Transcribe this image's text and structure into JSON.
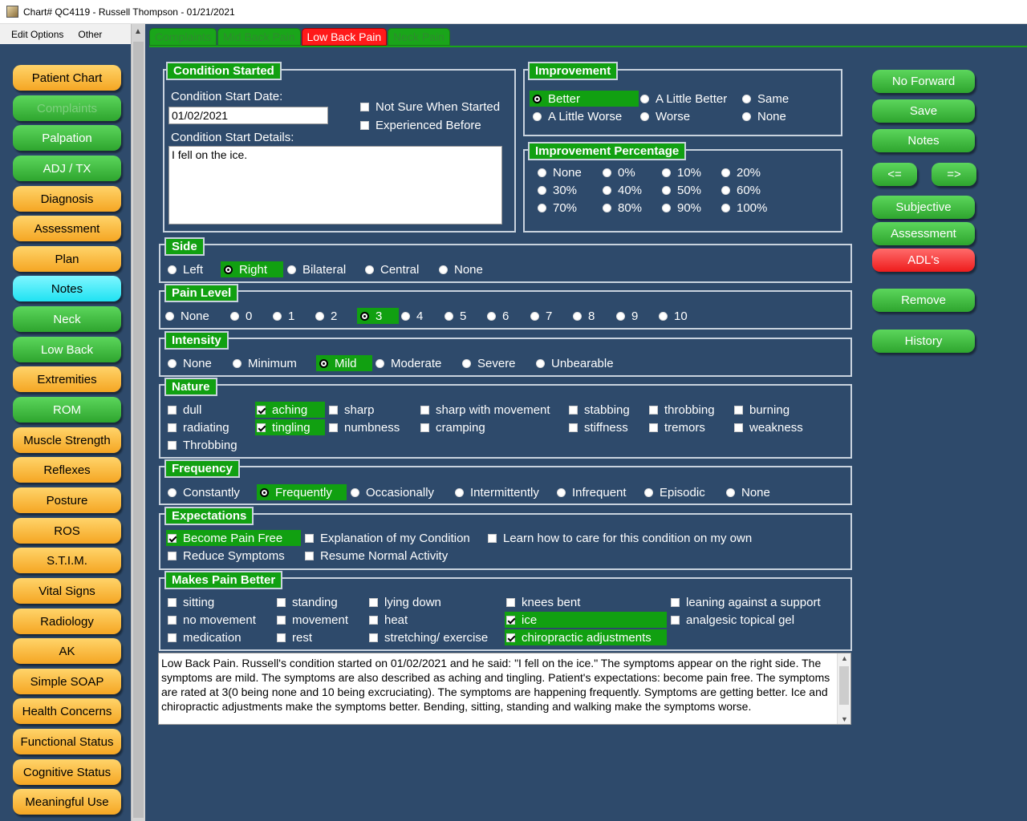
{
  "window": {
    "title": "Chart# QC4119 - Russell Thompson - 01/21/2021"
  },
  "menu": {
    "edit_options": "Edit Options",
    "other": "Other"
  },
  "sidebar": [
    "Patient Chart",
    "Complaints",
    "Palpation",
    "ADJ / TX",
    "Diagnosis",
    "Assessment",
    "Plan",
    "Notes",
    "Neck",
    "Low Back",
    "Extremities",
    "ROM",
    "Muscle Strength",
    "Reflexes",
    "Posture",
    "ROS",
    "S.T.I.M.",
    "Vital Signs",
    "Radiology",
    "AK",
    "Simple SOAP",
    "Health Concerns",
    "Functional Status",
    "Cognitive Status",
    "Meaningful Use"
  ],
  "tabs": [
    "Complaints",
    "Mid Back Pain",
    "Low Back Pain",
    "Neck Pain"
  ],
  "active_tab": "Low Back Pain",
  "condition": {
    "title": "Condition Started",
    "start_date_label": "Condition Start Date:",
    "start_date": "01/02/2021",
    "details_label": "Condition Start Details:",
    "details": "I fell on the ice.",
    "not_sure": "Not Sure When Started",
    "experienced": "Experienced Before"
  },
  "improvement": {
    "title": "Improvement",
    "options": [
      "Better",
      "A Little Better",
      "Same",
      "A Little Worse",
      "Worse",
      "None"
    ],
    "selected": "Better"
  },
  "improvement_pct": {
    "title": "Improvement Percentage",
    "options": [
      "None",
      "0%",
      "10%",
      "20%",
      "30%",
      "40%",
      "50%",
      "60%",
      "70%",
      "80%",
      "90%",
      "100%"
    ]
  },
  "side": {
    "title": "Side",
    "options": [
      "Left",
      "Right",
      "Bilateral",
      "Central",
      "None"
    ],
    "selected": "Right"
  },
  "pain_level": {
    "title": "Pain Level",
    "options": [
      "None",
      "0",
      "1",
      "2",
      "3",
      "4",
      "5",
      "6",
      "7",
      "8",
      "9",
      "10"
    ],
    "selected": "3"
  },
  "intensity": {
    "title": "Intensity",
    "options": [
      "None",
      "Minimum",
      "Mild",
      "Moderate",
      "Severe",
      "Unbearable"
    ],
    "selected": "Mild"
  },
  "nature": {
    "title": "Nature",
    "options": [
      "dull",
      "aching",
      "sharp",
      "sharp with movement",
      "stabbing",
      "throbbing",
      "burning",
      "radiating",
      "tingling",
      "numbness",
      "cramping",
      "stiffness",
      "tremors",
      "weakness",
      "Throbbing"
    ],
    "checked": [
      "aching",
      "tingling"
    ]
  },
  "frequency": {
    "title": "Frequency",
    "options": [
      "Constantly",
      "Frequently",
      "Occasionally",
      "Intermittently",
      "Infrequent",
      "Episodic",
      "None"
    ],
    "selected": "Frequently"
  },
  "expectations": {
    "title": "Expectations",
    "options": [
      "Become Pain Free",
      "Explanation of my Condition",
      "Learn how to care for this condition on my own",
      "Reduce Symptoms",
      "Resume Normal Activity"
    ],
    "checked": [
      "Become Pain Free"
    ]
  },
  "better": {
    "title": "Makes Pain Better",
    "options": [
      "sitting",
      "standing",
      "lying down",
      "knees bent",
      "leaning against a support",
      "no movement",
      "movement",
      "heat",
      "ice",
      "analgesic topical gel",
      "medication",
      "rest",
      "stretching/ exercise",
      "chiropractic adjustments"
    ],
    "checked": [
      "ice",
      "chiropractic adjustments"
    ]
  },
  "summary": "Low Back Pain.  Russell's condition started on 01/02/2021 and he said: \"I fell on the ice.\"  The symptoms appear on the right side.  The symptoms are mild.  The symptoms are also described as aching and tingling.  Patient's expectations: become pain free.  The symptoms are rated at 3(0 being none and 10 being excruciating).  The symptoms are happening frequently.  Symptoms are getting better.  Ice and chiropractic adjustments make the symptoms better.    Bending, sitting, standing and walking make the symptoms worse.",
  "right_buttons": {
    "no_forward": "No Forward",
    "save": "Save",
    "notes": "Notes",
    "prev": "<=",
    "next": "=>",
    "subjective": "Subjective",
    "assessment": "Assessment",
    "adls": "ADL's",
    "remove": "Remove",
    "history": "History"
  }
}
